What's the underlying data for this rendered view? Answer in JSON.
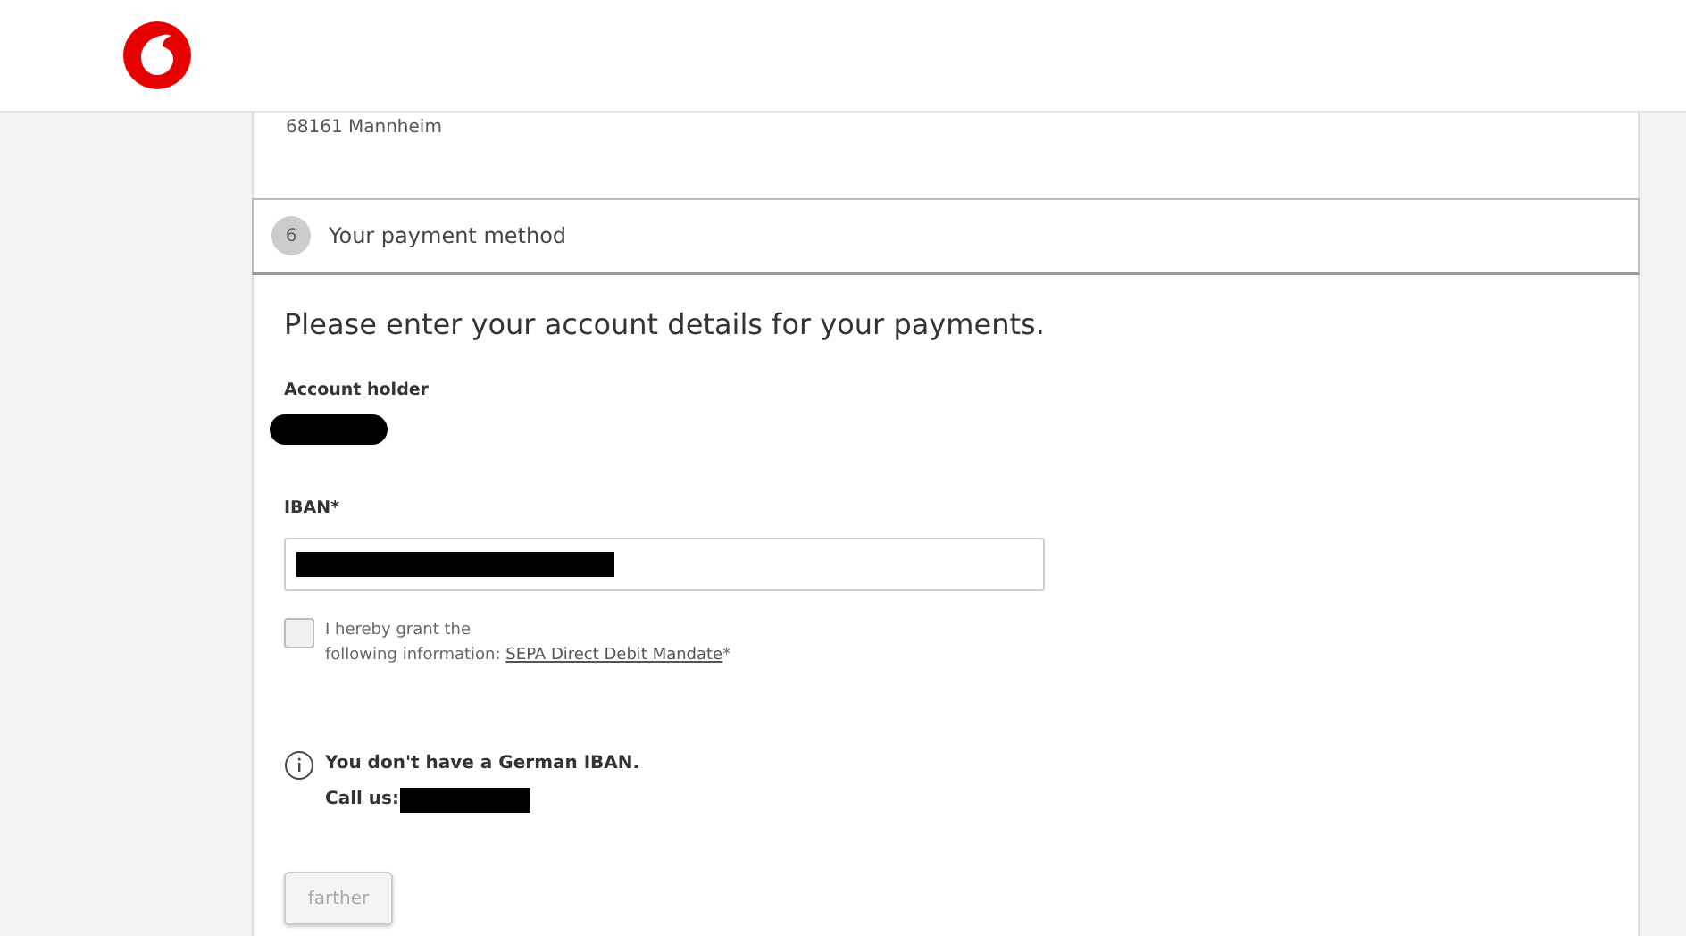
{
  "address": {
    "city_line": "68161 Mannheim"
  },
  "step": {
    "number": "6",
    "title": "Your payment method"
  },
  "form": {
    "heading": "Please enter your account details for your payments.",
    "holder_label": "Account holder",
    "iban_label": "IBAN*",
    "mandate": {
      "checked": false,
      "text": "I hereby grant the",
      "text_2": "following information: ",
      "link": "SEPA Direct Debit Mandate",
      "suffix": "*"
    },
    "notice": {
      "title": "You don't have a German IBAN.",
      "call_label": "Call us:"
    },
    "submit": {
      "label": "farther",
      "disabled": true
    }
  }
}
